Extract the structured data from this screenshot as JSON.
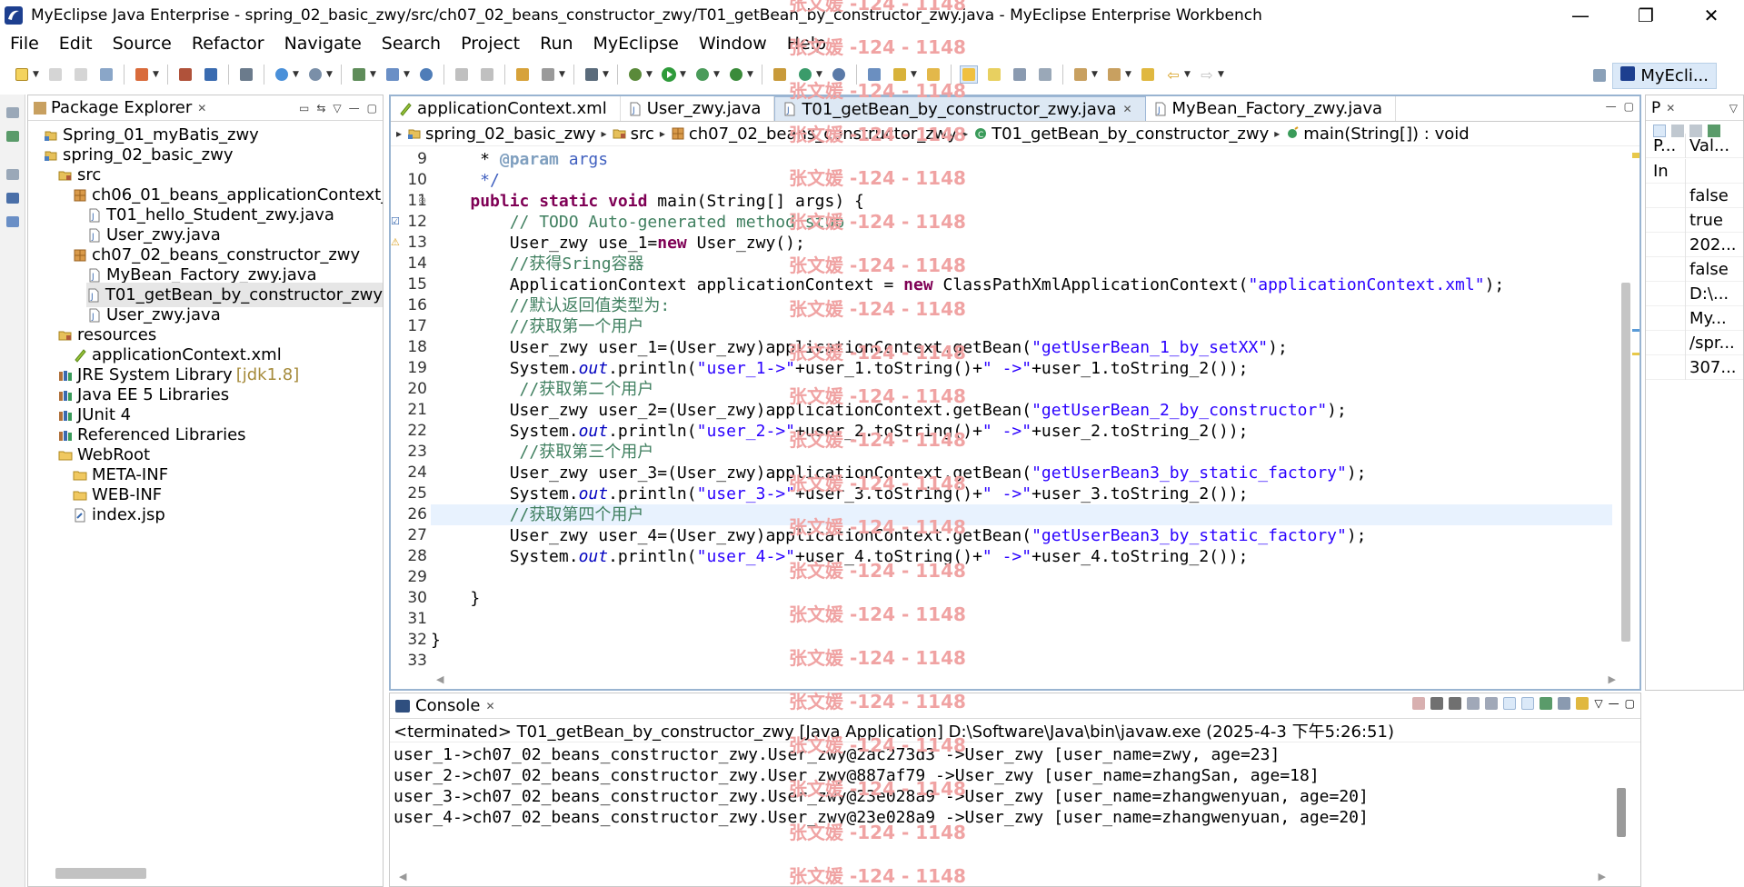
{
  "window": {
    "title": "MyEclipse Java Enterprise - spring_02_basic_zwy/src/ch07_02_beans_constructor_zwy/T01_getBean_by_constructor_zwy.java - MyEclipse Enterprise Workbench",
    "minimize": "—",
    "maximize": "❐",
    "close": "✕"
  },
  "menu": [
    "File",
    "Edit",
    "Source",
    "Refactor",
    "Navigate",
    "Search",
    "Project",
    "Run",
    "MyEclipse",
    "Window",
    "Help"
  ],
  "perspective": {
    "label": "MyEcli..."
  },
  "package_explorer": {
    "title": "Package Explorer",
    "items": [
      {
        "label": "Spring_01_myBatis_zwy",
        "icon": "project-icon",
        "indent": 0
      },
      {
        "label": "spring_02_basic_zwy",
        "icon": "project-icon",
        "indent": 0
      },
      {
        "label": "src",
        "icon": "source-folder-icon",
        "indent": 1
      },
      {
        "label": "ch06_01_beans_applicationContext_",
        "icon": "package-icon",
        "indent": 2
      },
      {
        "label": "T01_hello_Student_zwy.java",
        "icon": "java-file-icon",
        "indent": 3
      },
      {
        "label": "User_zwy.java",
        "icon": "java-file-icon",
        "indent": 3
      },
      {
        "label": "ch07_02_beans_constructor_zwy",
        "icon": "package-icon",
        "indent": 2
      },
      {
        "label": "MyBean_Factory_zwy.java",
        "icon": "java-file-icon",
        "indent": 3
      },
      {
        "label": "T01_getBean_by_constructor_zwy",
        "icon": "java-file-icon",
        "indent": 3,
        "selected": true
      },
      {
        "label": "User_zwy.java",
        "icon": "java-file-icon",
        "indent": 3
      },
      {
        "label": "resources",
        "icon": "source-folder-icon",
        "indent": 1
      },
      {
        "label": "applicationContext.xml",
        "icon": "xml-file-icon",
        "indent": 2
      },
      {
        "label": "JRE System Library",
        "decor": "[jdk1.8]",
        "icon": "library-icon",
        "indent": 1
      },
      {
        "label": "Java EE 5 Libraries",
        "icon": "library-icon",
        "indent": 1
      },
      {
        "label": "JUnit 4",
        "icon": "library-icon",
        "indent": 1
      },
      {
        "label": "Referenced Libraries",
        "icon": "library-icon",
        "indent": 1
      },
      {
        "label": "WebRoot",
        "icon": "folder-icon",
        "indent": 1
      },
      {
        "label": "META-INF",
        "icon": "folder-icon",
        "indent": 2
      },
      {
        "label": "WEB-INF",
        "icon": "folder-icon",
        "indent": 2
      },
      {
        "label": "index.jsp",
        "icon": "jsp-file-icon",
        "indent": 2
      }
    ]
  },
  "editor": {
    "tabs": [
      {
        "label": "applicationContext.xml",
        "icon": "xml-file-icon",
        "active": false
      },
      {
        "label": "User_zwy.java",
        "icon": "java-file-icon",
        "active": false
      },
      {
        "label": "T01_getBean_by_constructor_zwy.java",
        "icon": "java-file-icon",
        "active": true
      },
      {
        "label": "MyBean_Factory_zwy.java",
        "icon": "java-file-icon",
        "active": false
      }
    ],
    "breadcrumb": [
      {
        "label": "spring_02_basic_zwy",
        "icon": "project-icon"
      },
      {
        "label": "src",
        "icon": "source-folder-icon"
      },
      {
        "label": "ch07_02_beans_constructor_zwy",
        "icon": "package-icon"
      },
      {
        "label": "T01_getBean_by_constructor_zwy",
        "icon": "class-icon"
      },
      {
        "label": "main(String[]) : void",
        "icon": "method-icon"
      }
    ],
    "current_line": 26,
    "lines": [
      {
        "n": "9",
        "parts": [
          [
            "",
            "     * "
          ],
          [
            "tag",
            "@param"
          ],
          [
            "cmd",
            " args"
          ]
        ]
      },
      {
        "n": "10",
        "parts": [
          [
            "cmd",
            "     */"
          ]
        ]
      },
      {
        "n": "11",
        "parts": [
          [
            "",
            "    "
          ],
          [
            "kw",
            "public static void"
          ],
          [
            "",
            " main(String[] args) {"
          ]
        ]
      },
      {
        "n": "12",
        "parts": [
          [
            "",
            "        "
          ],
          [
            "cm",
            "// TODO Auto-generated method stub"
          ]
        ]
      },
      {
        "n": "13",
        "parts": [
          [
            "",
            "        User_zwy use_1="
          ],
          [
            "kw",
            "new"
          ],
          [
            "",
            " User_zwy();"
          ]
        ]
      },
      {
        "n": "14",
        "parts": [
          [
            "",
            "        "
          ],
          [
            "cm",
            "//获得Sring容器"
          ]
        ]
      },
      {
        "n": "15",
        "parts": [
          [
            "",
            "        ApplicationContext applicationContext = "
          ],
          [
            "kw",
            "new"
          ],
          [
            "",
            " ClassPathXmlApplicationContext("
          ],
          [
            "str",
            "\"applicationContext.xml\""
          ],
          [
            "",
            ");"
          ]
        ]
      },
      {
        "n": "16",
        "parts": [
          [
            "",
            "        "
          ],
          [
            "cm",
            "//默认返回值类型为:"
          ]
        ]
      },
      {
        "n": "17",
        "parts": [
          [
            "",
            "        "
          ],
          [
            "cm",
            "//获取第一个用户"
          ]
        ]
      },
      {
        "n": "18",
        "parts": [
          [
            "",
            "        User_zwy user_1=(User_zwy)applicationContext.getBean("
          ],
          [
            "str",
            "\"getUserBean_1_by_setXX\""
          ],
          [
            "",
            ");"
          ]
        ]
      },
      {
        "n": "19",
        "parts": [
          [
            "",
            "        System."
          ],
          [
            "fld",
            "out"
          ],
          [
            "",
            ".println("
          ],
          [
            "str",
            "\"user_1->\""
          ],
          [
            "",
            "+user_1.toString()+"
          ],
          [
            "str",
            "\" ->\""
          ],
          [
            "",
            "+user_1.toString_2());"
          ]
        ]
      },
      {
        "n": "20",
        "parts": [
          [
            "",
            "         "
          ],
          [
            "cm",
            "//获取第二个用户"
          ]
        ]
      },
      {
        "n": "21",
        "parts": [
          [
            "",
            "        User_zwy user_2=(User_zwy)applicationContext.getBean("
          ],
          [
            "str",
            "\"getUserBean_2_by_constructor\""
          ],
          [
            "",
            ");"
          ]
        ]
      },
      {
        "n": "22",
        "parts": [
          [
            "",
            "        System."
          ],
          [
            "fld",
            "out"
          ],
          [
            "",
            ".println("
          ],
          [
            "str",
            "\"user_2->\""
          ],
          [
            "",
            "+user_2.toString()+"
          ],
          [
            "str",
            "\" ->\""
          ],
          [
            "",
            "+user_2.toString_2());"
          ]
        ]
      },
      {
        "n": "23",
        "parts": [
          [
            "",
            "         "
          ],
          [
            "cm",
            "//获取第三个用户"
          ]
        ]
      },
      {
        "n": "24",
        "parts": [
          [
            "",
            "        User_zwy user_3=(User_zwy)applicationContext.getBean("
          ],
          [
            "str",
            "\"getUserBean3_by_static_factory\""
          ],
          [
            "",
            ");"
          ]
        ]
      },
      {
        "n": "25",
        "parts": [
          [
            "",
            "        System."
          ],
          [
            "fld",
            "out"
          ],
          [
            "",
            ".println("
          ],
          [
            "str",
            "\"user_3->\""
          ],
          [
            "",
            "+user_3.toString()+"
          ],
          [
            "str",
            "\" ->\""
          ],
          [
            "",
            "+user_3.toString_2());"
          ]
        ]
      },
      {
        "n": "26",
        "parts": [
          [
            "",
            "        "
          ],
          [
            "cm",
            "//获取第四个用户"
          ]
        ]
      },
      {
        "n": "27",
        "parts": [
          [
            "",
            "        User_zwy user_4=(User_zwy)applicationContext.getBean("
          ],
          [
            "str",
            "\"getUserBean3_by_static_factory\""
          ],
          [
            "",
            ");"
          ]
        ]
      },
      {
        "n": "28",
        "parts": [
          [
            "",
            "        System."
          ],
          [
            "fld",
            "out"
          ],
          [
            "",
            ".println("
          ],
          [
            "str",
            "\"user_4->\""
          ],
          [
            "",
            "+user_4.toString()+"
          ],
          [
            "str",
            "\" ->\""
          ],
          [
            "",
            "+user_4.toString_2());"
          ]
        ]
      },
      {
        "n": "29",
        "parts": [
          [
            "",
            ""
          ]
        ]
      },
      {
        "n": "30",
        "parts": [
          [
            "",
            "    }"
          ]
        ]
      },
      {
        "n": "31",
        "parts": [
          [
            "",
            ""
          ]
        ]
      },
      {
        "n": "32",
        "parts": [
          [
            "",
            "}"
          ]
        ]
      },
      {
        "n": "33",
        "parts": [
          [
            "",
            ""
          ]
        ]
      }
    ]
  },
  "properties": {
    "title": "P",
    "col_property": "P...",
    "col_value": "Val...",
    "rows": [
      {
        "k": "In",
        "v": ""
      },
      {
        "k": "",
        "v": "false"
      },
      {
        "k": "",
        "v": "true"
      },
      {
        "k": "",
        "v": "202..."
      },
      {
        "k": "",
        "v": "false"
      },
      {
        "k": "",
        "v": "D:\\..."
      },
      {
        "k": "",
        "v": "My..."
      },
      {
        "k": "",
        "v": "/spr..."
      },
      {
        "k": "",
        "v": "307..."
      }
    ]
  },
  "console": {
    "title": "Console",
    "status": "<terminated> T01_getBean_by_constructor_zwy [Java Application] D:\\Software\\Java\\bin\\javaw.exe (2025-4-3 下午5:26:51)",
    "lines": [
      "user_1->ch07_02_beans_constructor_zwy.User_zwy@2ac273d3 ->User_zwy [user_name=zwy, age=23]",
      "user_2->ch07_02_beans_constructor_zwy.User_zwy@887af79 ->User_zwy [user_name=zhangSan, age=18]",
      "user_3->ch07_02_beans_constructor_zwy.User_zwy@23e028a9 ->User_zwy [user_name=zhangwenyuan, age=20]",
      "user_4->ch07_02_beans_constructor_zwy.User_zwy@23e028a9 ->User_zwy [user_name=zhangwenyuan, age=20]"
    ]
  },
  "watermark": {
    "text": "张文媛 -124 - 1148",
    "color": "#f0a3a3"
  }
}
